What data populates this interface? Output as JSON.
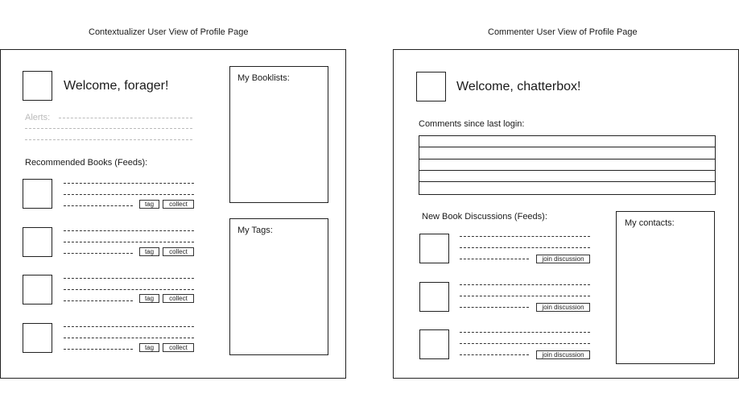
{
  "left": {
    "caption": "Contextualizer User View of Profile Page",
    "welcome": "Welcome, forager!",
    "alerts_label": "Alerts:",
    "feeds_label": "Recommended Books (Feeds):",
    "tag_label": "tag",
    "collect_label": "collect",
    "booklists_title": "My Booklists:",
    "tags_title": "My Tags:"
  },
  "right": {
    "caption": "Commenter User View of Profile Page",
    "welcome": "Welcome, chatterbox!",
    "comments_label": "Comments since last login:",
    "feeds_label": "New Book Discussions (Feeds):",
    "join_label": "join discussion",
    "contacts_title": "My contacts:"
  }
}
